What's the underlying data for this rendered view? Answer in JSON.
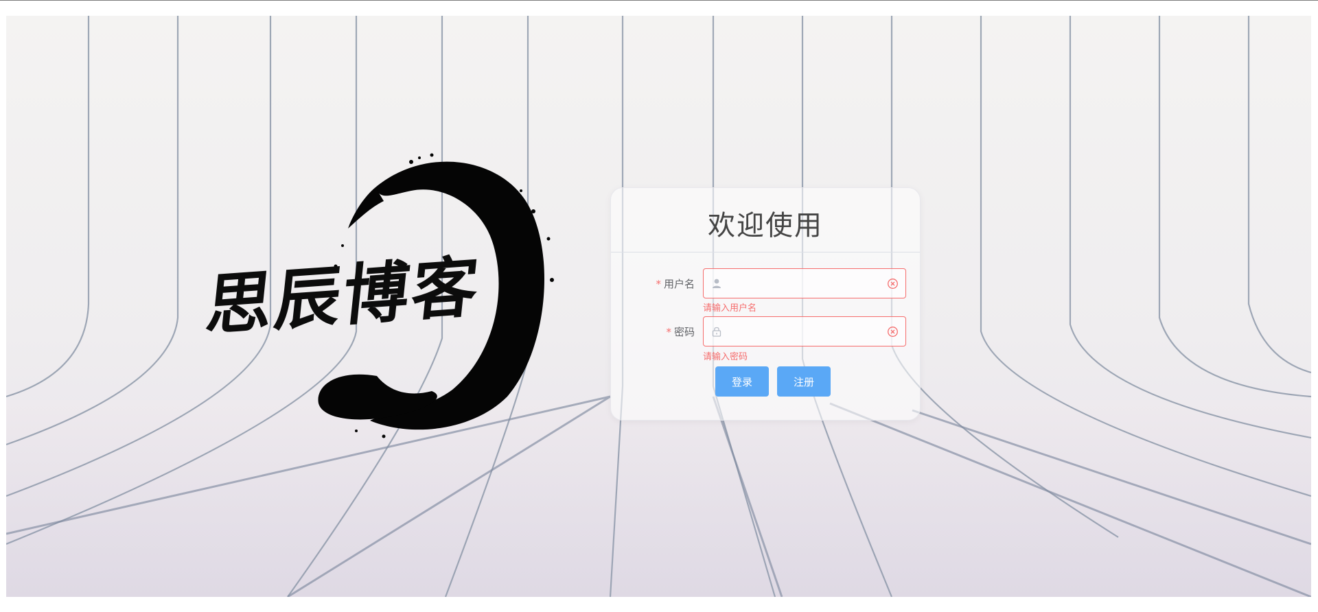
{
  "brand": {
    "logo_text": "思辰博客"
  },
  "login": {
    "title": "欢迎使用",
    "username": {
      "label": "用户名",
      "required_mark": "*",
      "value": "",
      "error": "请输入用户名",
      "icon": "user-icon"
    },
    "password": {
      "label": "密码",
      "required_mark": "*",
      "value": "",
      "error": "请输入密码",
      "icon": "lock-icon"
    },
    "buttons": {
      "login_label": "登录",
      "register_label": "注册"
    }
  },
  "colors": {
    "error": "#f56c6c",
    "primary_button": "#5aa8f6",
    "title_text": "#444444"
  }
}
